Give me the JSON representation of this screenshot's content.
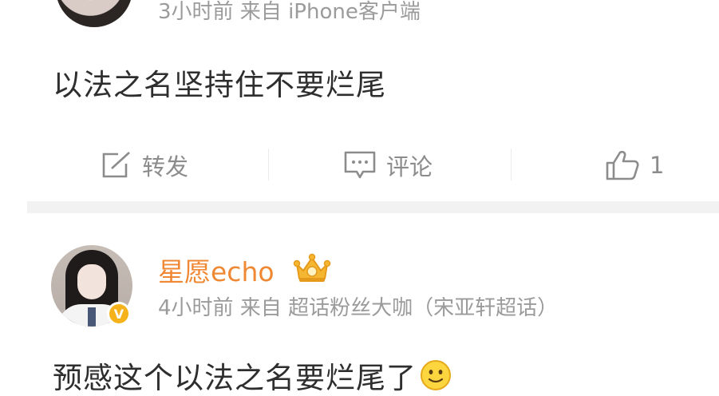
{
  "post1": {
    "meta": "3小时前 来自 iPhone客户端",
    "content": "以法之名坚持住不要烂尾",
    "actions": {
      "repost_label": "转发",
      "comment_label": "评论",
      "like_count": "1"
    }
  },
  "post2": {
    "username": "星愿echo",
    "verified_badge": "V",
    "meta": "4小时前 来自 超话粉丝大咖（宋亚轩超话）",
    "content": "预感这个以法之名要烂尾了"
  },
  "icons": {
    "repost": "edit-repost-icon",
    "comment": "comment-bubble-icon",
    "like": "thumbs-up-icon",
    "crown": "crown-icon",
    "smiley": "smiley-emoji-icon"
  },
  "colors": {
    "username": "#f08833",
    "meta": "#9b9b9b",
    "action": "#8c8c8c",
    "divider": "#f2f2f2"
  }
}
